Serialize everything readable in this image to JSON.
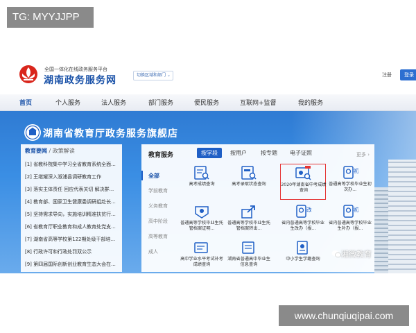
{
  "overlay": {
    "tg_label": "TG: MYYJJPP",
    "url_label": "www.chunqiuqipai.com"
  },
  "header": {
    "slogan": "全国一体化在线政务服务平台",
    "site_name": "湖南政务服务网",
    "region_select": "切换区域和部门 ⌄",
    "login": "注册",
    "register": "登录"
  },
  "nav": {
    "items": [
      {
        "label": "首页"
      },
      {
        "label": "个人服务"
      },
      {
        "label": "法人服务"
      },
      {
        "label": "部门服务"
      },
      {
        "label": "便民服务"
      },
      {
        "label": "互联网+监督"
      },
      {
        "label": "我的服务"
      }
    ]
  },
  "banner": {
    "title": "湖南省教育厅政务服务旗舰店"
  },
  "news": {
    "head_active": "教育要闻",
    "head_sep": " / ",
    "head_other": "政策解读",
    "items": [
      "[1]  省教科院集中学习全省教育系统全面...",
      "[2]  王继耀深入溆浦县调研教育工作",
      "[3]  落实主体责任 回应代表关切 解决群...",
      "[4]  教育部、国家卫生健康委调研组赴长...",
      "[5]  坚持需求导向，实施培训精准扶贫行...",
      "[6]  省教育厅职业教育和成人教育处党支...",
      "[7]  湖南省高等学校第122期处级干部培...",
      "[8]  行政许可和行政处罚双公示",
      "[9]  第四届国际创新创业教育生态大会在..."
    ]
  },
  "panel": {
    "title": "教育服务",
    "tabs": [
      "按学段",
      "按用户",
      "按专题",
      "电子证照"
    ],
    "more": "更多 ›",
    "side": [
      "全部",
      "学前教育",
      "义务教育",
      "高中阶段",
      "高等教育",
      "成人"
    ],
    "services": [
      "高考成绩查询",
      "高考录取状态查询",
      "2020年湖南省中考成绩查询",
      "普通高等学校毕业生初次办...",
      "普通高等学校毕业生托管档案证明...",
      "普通高等学校毕业生托管档案转出...",
      "省内普通高等学校毕业生改办（报...",
      "省内普通高等学校毕业生补办（报...",
      "高中学业水平考试补考成绩查询",
      "湖南省普通高中毕业生信息查询",
      "中小学生学籍查询"
    ],
    "badges": {
      "first": "初",
      "change": "改"
    }
  },
  "watermark": {
    "text": "湘微教育"
  },
  "colors": {
    "brand_blue": "#1a52a8",
    "tab_blue": "#1f5fc5",
    "highlight_red": "#e53535"
  },
  "icons": [
    "hunan-logo-icon",
    "education-emblem-icon",
    "score-search-icon",
    "admission-search-icon",
    "certificate-icon",
    "archive-icon",
    "export-icon",
    "stamp-icon",
    "wechat-icon"
  ]
}
